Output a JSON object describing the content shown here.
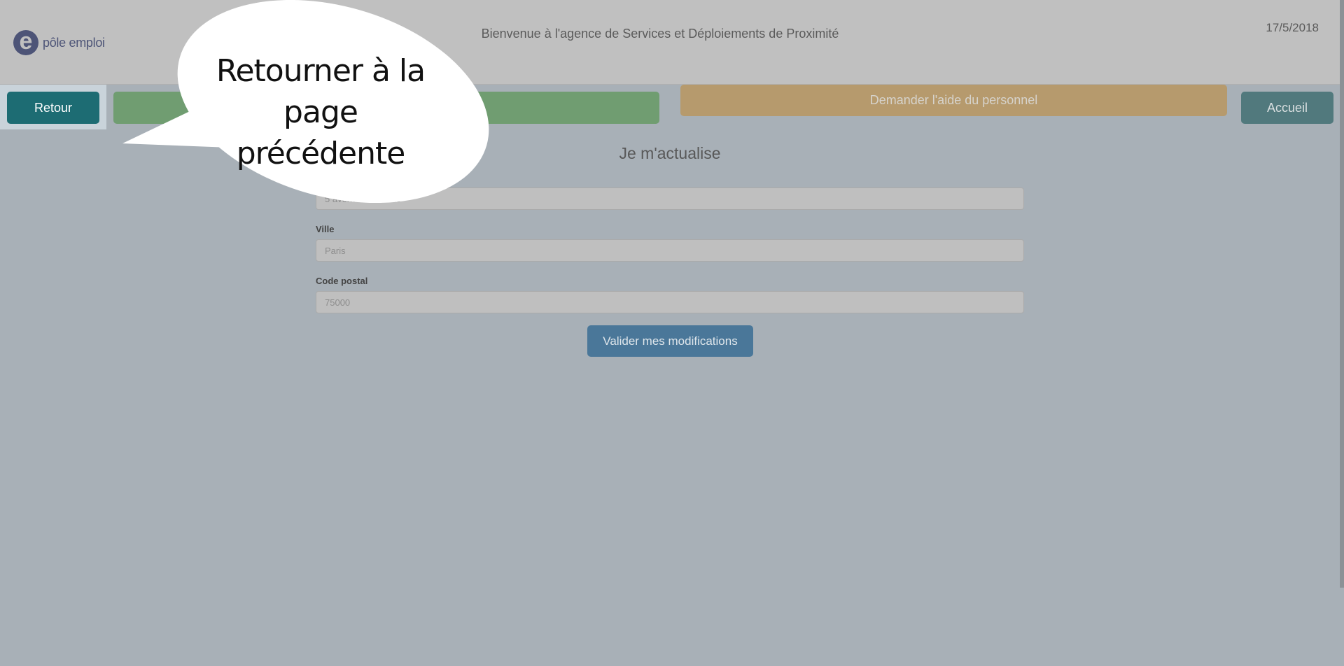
{
  "header": {
    "logo_mark": "e",
    "logo_text": "pôle emploi",
    "welcome": "Bienvenue à l'agence de Services et Déploiements de Proximité",
    "date": "17/5/2018"
  },
  "toolbar": {
    "retour": "Retour",
    "green_button": "",
    "aide": "Demander l'aide du personnel",
    "accueil": "Accueil"
  },
  "form": {
    "title": "Je m'actualise",
    "address_value": "5 avenue des Lilas",
    "ville_label": "Ville",
    "ville_value": "Paris",
    "cp_label": "Code postal",
    "cp_value": "75000",
    "submit": "Valider mes modifications"
  },
  "tooltip": {
    "line1": "Retourner à la page",
    "line2": "précédente"
  },
  "colors": {
    "overlay_bg": "#a8b0b7",
    "retour": "#1d6c73",
    "green": "#709d71",
    "orange": "#b69a6d",
    "accueil": "#51797d",
    "valider": "#4a7799"
  }
}
